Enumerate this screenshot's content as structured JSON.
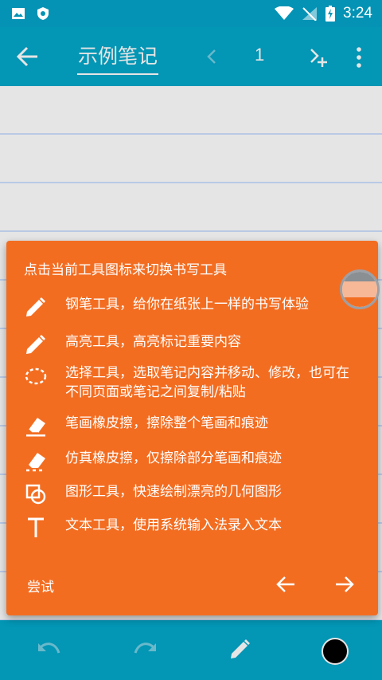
{
  "status_bar": {
    "time": "3:24"
  },
  "app_bar": {
    "title": "示例笔记",
    "page_number": "1"
  },
  "tip": {
    "header": "点击当前工具图标来切换书写工具",
    "items": [
      {
        "icon": "pen-icon",
        "text": "钢笔工具，给你在纸张上一样的书写体验"
      },
      {
        "icon": "highlighter-icon",
        "text": "高亮工具，高亮标记重要内容"
      },
      {
        "icon": "lasso-select-icon",
        "text": "选择工具，选取笔记内容并移动、修改，也可在不同页面或笔记之间复制/粘贴"
      },
      {
        "icon": "stroke-eraser-icon",
        "text": "笔画橡皮擦，擦除整个笔画和痕迹"
      },
      {
        "icon": "simulated-eraser-icon",
        "text": "仿真橡皮擦，仅擦除部分笔画和痕迹"
      },
      {
        "icon": "shape-tool-icon",
        "text": "图形工具，快速绘制漂亮的几何图形"
      },
      {
        "icon": "text-tool-icon",
        "text": "文本工具，使用系统输入法录入文本"
      }
    ],
    "try_label": "尝试"
  },
  "colors": {
    "status_bar": "#0493b5",
    "app_bar": "#04a7ca",
    "tip_card": "#f36d21",
    "ruled_line": "#cfe0ff",
    "current_pen_color": "#000000"
  }
}
